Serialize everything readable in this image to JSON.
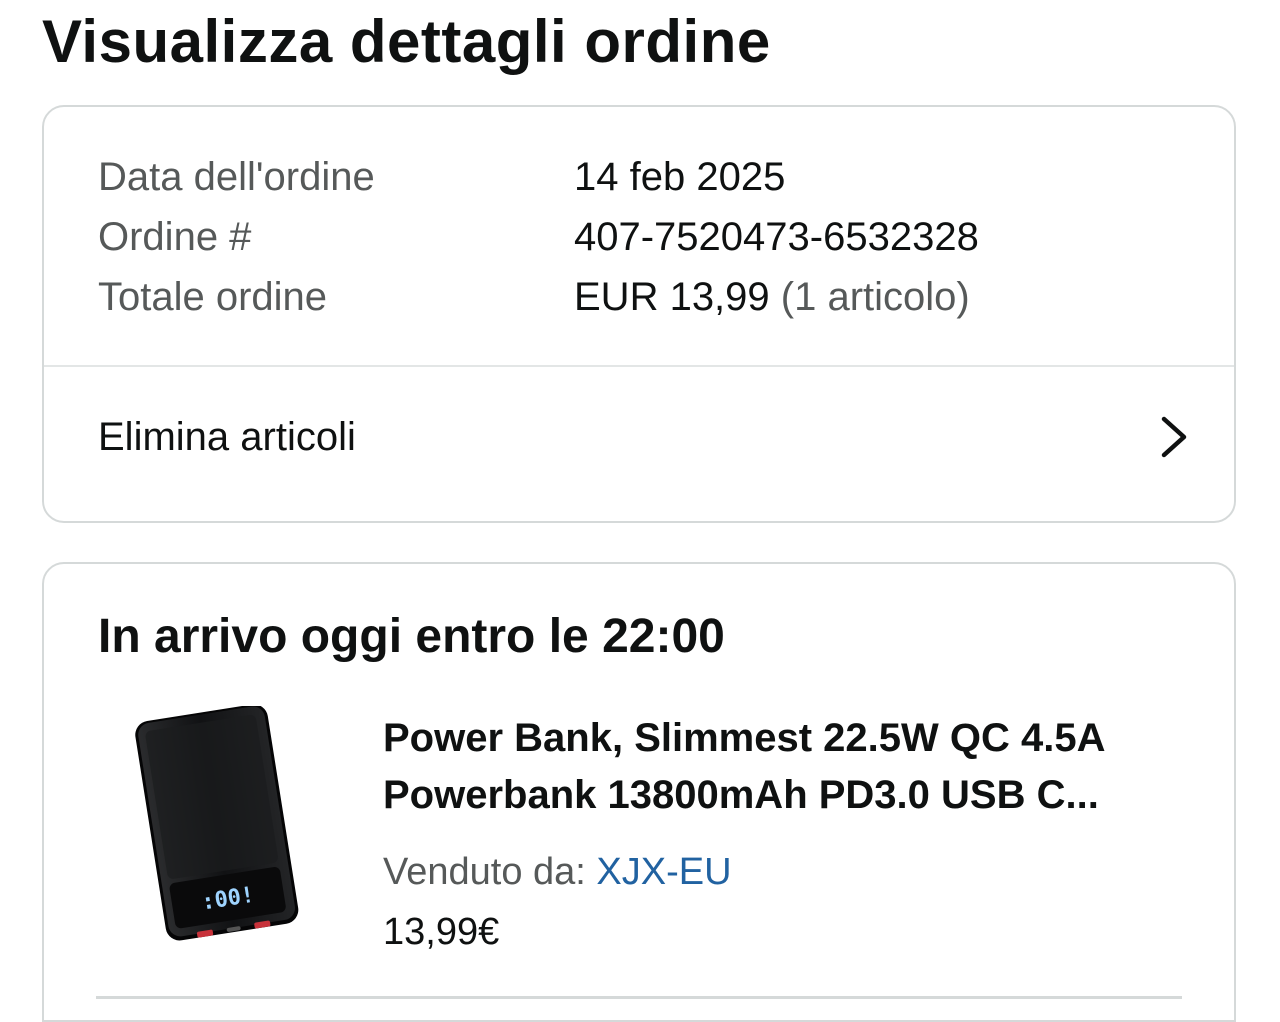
{
  "page": {
    "title": "Visualizza dettagli ordine"
  },
  "order_summary": {
    "rows": [
      {
        "label": "Data dell'ordine",
        "value": "14 feb 2025"
      },
      {
        "label": "Ordine #",
        "value": "407-7520473-6532328"
      },
      {
        "label": "Totale ordine",
        "value": "EUR 13,99",
        "extra": "(1 articolo)"
      }
    ],
    "action": {
      "label": "Elimina articoli",
      "icon": "chevron-right-icon"
    }
  },
  "shipment": {
    "heading": "In arrivo oggi entro le 22:00",
    "product": {
      "image_icon": "power-bank-image",
      "display_readout": ":00!",
      "title": "Power Bank, Slimmest 22.5W QC 4.5A Powerbank 13800mAh PD3.0 USB C...",
      "seller_label": "Venduto da:",
      "seller_name": "XJX-EU",
      "price": "13,99€"
    }
  },
  "colors": {
    "text": "#0f1111",
    "muted": "#565959",
    "link": "#2162a1",
    "border": "#d5d9d9"
  }
}
